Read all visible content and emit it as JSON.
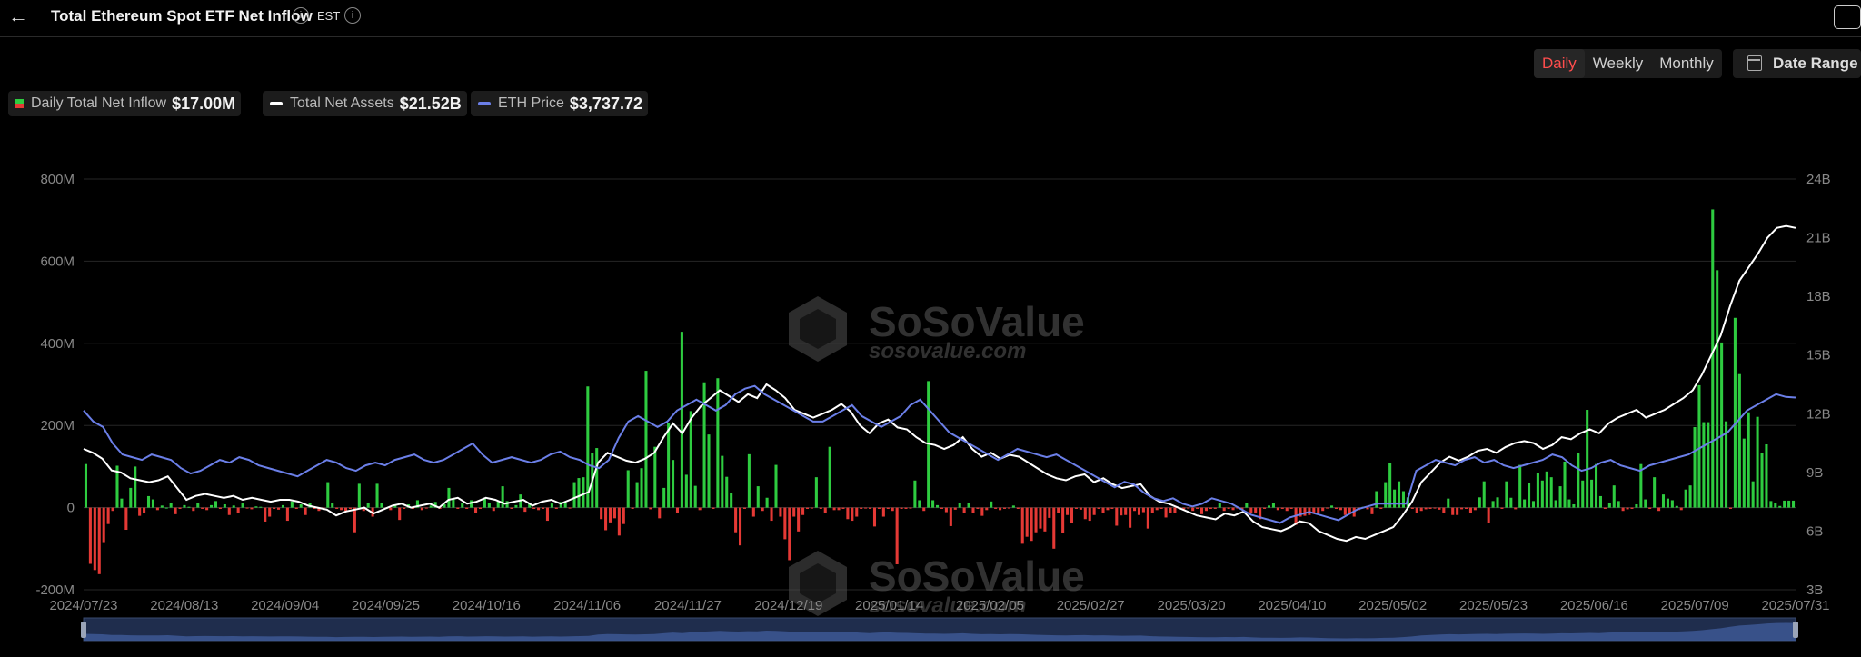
{
  "header": {
    "title": "Total Ethereum Spot ETF Net Inflow",
    "timezone": "EST",
    "info_glyph": "i"
  },
  "period_tabs": [
    {
      "label": "Daily",
      "active": true
    },
    {
      "label": "Weekly",
      "active": false
    },
    {
      "label": "Monthly",
      "active": false
    }
  ],
  "date_range_label": "Date Range",
  "legend": [
    {
      "label": "Daily Total Net Inflow",
      "value": "$17.00M",
      "color": "#2ecc40"
    },
    {
      "label": "Total Net Assets",
      "value": "$21.52B",
      "color": "#ffffff"
    },
    {
      "label": "ETH Price",
      "value": "$3,737.72",
      "color": "#6b7fe8"
    }
  ],
  "watermark": {
    "name": "SoSoValue",
    "url": "sosovalue.com"
  },
  "chart_data": {
    "type": "bar",
    "x": [
      "2024/07/23",
      "2024/08/13",
      "2024/09/04",
      "2024/09/25",
      "2024/10/16",
      "2024/11/06",
      "2024/11/27",
      "2024/12/19",
      "2025/01/14",
      "2025/02/05",
      "2025/02/27",
      "2025/03/20",
      "2025/04/10",
      "2025/05/02",
      "2025/05/23",
      "2025/06/16",
      "2025/07/09",
      "2025/07/31"
    ],
    "y_left": {
      "ticks": [
        "-200M",
        "0",
        "200M",
        "400M",
        "600M",
        "800M"
      ],
      "range": [
        -200,
        800
      ],
      "unit": "M"
    },
    "y_right": {
      "ticks": [
        "3B",
        "6B",
        "9B",
        "12B",
        "15B",
        "18B",
        "21B",
        "24B"
      ],
      "range": [
        3,
        24
      ],
      "unit": "B"
    },
    "series": [
      {
        "name": "Daily Total Net Inflow",
        "type": "bar",
        "unit": "M",
        "positive_color": "#2ecc40",
        "negative_color": "#e53935",
        "values": [
          106,
          -137,
          -152,
          -162,
          -84,
          -40,
          -8,
          102,
          22,
          -54,
          48,
          100,
          -20,
          -12,
          28,
          20,
          -6,
          5,
          0,
          12,
          -16,
          -3,
          6,
          2,
          -8,
          12,
          -3,
          -6,
          6,
          16,
          -3,
          8,
          -18,
          5,
          -12,
          12,
          -2,
          -4,
          3,
          2,
          -34,
          -22,
          -3,
          -5,
          6,
          -32,
          15,
          -3,
          8,
          -18,
          12,
          -3,
          -8,
          -2,
          62,
          12,
          -3,
          -6,
          -8,
          -3,
          -60,
          58,
          -8,
          12,
          -22,
          58,
          12,
          -3,
          -6,
          8,
          -30,
          -3,
          8,
          -3,
          18,
          -6,
          -2,
          5,
          14,
          -3,
          8,
          48,
          22,
          -3,
          12,
          -3,
          18,
          -12,
          -3,
          22,
          12,
          -8,
          15,
          52,
          16,
          -3,
          6,
          32,
          -10,
          12,
          -3,
          -6,
          -3,
          -32,
          10,
          -3,
          14,
          12,
          -2,
          62,
          72,
          74,
          295,
          134,
          145,
          -28,
          -55,
          -36,
          -26,
          -68,
          -40,
          91,
          -3,
          62,
          96,
          333,
          -4,
          148,
          -26,
          48,
          205,
          116,
          -14,
          428,
          80,
          235,
          53,
          -6,
          305,
          178,
          -3,
          315,
          126,
          75,
          36,
          -60,
          -92,
          -3,
          130,
          -22,
          52,
          -8,
          24,
          -32,
          104,
          -22,
          -77,
          -128,
          -22,
          -58,
          -18,
          -3,
          -2,
          74,
          -3,
          -12,
          148,
          -6,
          -6,
          -3,
          -28,
          -32,
          -22,
          -3,
          -2,
          -3,
          -46,
          -3,
          -22,
          -3,
          -8,
          -138,
          -3,
          -3,
          -2,
          66,
          18,
          -8,
          308,
          18,
          6,
          -3,
          -11,
          -45,
          -5,
          12,
          -13,
          12,
          -12,
          -3,
          -20,
          -6,
          15,
          -3,
          -6,
          -3,
          -2,
          5,
          -3,
          -88,
          -71,
          -81,
          -60,
          -51,
          -58,
          -25,
          -100,
          -12,
          -62,
          -18,
          -38,
          -3,
          -5,
          -28,
          -32,
          -18,
          -3,
          -12,
          -6,
          -3,
          -44,
          -19,
          -18,
          -49,
          -8,
          -18,
          -11,
          -51,
          -14,
          -6,
          -3,
          -24,
          -14,
          -12,
          -3,
          -4,
          -2,
          -8,
          -3,
          -16,
          -8,
          -3,
          -3,
          12,
          -8,
          -3,
          -6,
          -2,
          -5,
          12,
          -12,
          -14,
          -28,
          -3,
          5,
          12,
          -6,
          -3,
          -8,
          -3,
          -42,
          -22,
          -20,
          -18,
          -12,
          -14,
          -8,
          -2,
          5,
          -3,
          -6,
          -18,
          -12,
          -22,
          -6,
          2,
          -4,
          -16,
          40,
          -3,
          62,
          108,
          44,
          64,
          40,
          25,
          -3,
          -12,
          -8,
          -4,
          -3,
          -2,
          -5,
          -12,
          22,
          -18,
          -18,
          -4,
          -3,
          -12,
          -6,
          25,
          64,
          -38,
          16,
          25,
          -3,
          64,
          24,
          -4,
          104,
          20,
          60,
          16,
          84,
          66,
          88,
          74,
          18,
          52,
          112,
          20,
          8,
          134,
          66,
          238,
          68,
          106,
          28,
          -3,
          12,
          54,
          16,
          -8,
          -4,
          -3,
          8,
          106,
          20,
          -3,
          74,
          -8,
          32,
          22,
          18,
          4,
          -6,
          44,
          54,
          196,
          298,
          208,
          208,
          726,
          578,
          402,
          210,
          -3,
          462,
          325,
          168,
          232,
          64,
          221,
          134,
          154,
          16,
          11,
          4,
          17,
          17,
          17
        ]
      },
      {
        "name": "Total Net Assets",
        "type": "line",
        "unit": "B",
        "color": "#ffffff",
        "values": [
          10.2,
          10.0,
          9.7,
          9.1,
          9.0,
          8.7,
          8.6,
          8.5,
          8.6,
          8.8,
          8.2,
          7.6,
          7.8,
          7.9,
          7.8,
          7.7,
          7.8,
          7.6,
          7.7,
          7.6,
          7.5,
          7.6,
          7.6,
          7.5,
          7.3,
          7.2,
          7.1,
          6.8,
          7.0,
          7.1,
          7.2,
          6.9,
          7.1,
          7.3,
          7.4,
          7.2,
          7.3,
          7.4,
          7.2,
          7.6,
          7.7,
          7.4,
          7.5,
          7.7,
          7.6,
          7.4,
          7.5,
          7.6,
          7.3,
          7.5,
          7.6,
          7.4,
          7.6,
          7.8,
          8.0,
          9.5,
          10.0,
          9.8,
          9.6,
          9.5,
          9.7,
          10.0,
          10.8,
          11.5,
          11.0,
          11.8,
          12.4,
          12.8,
          13.2,
          12.9,
          12.6,
          13.0,
          12.8,
          13.5,
          13.2,
          12.8,
          12.2,
          12.0,
          11.8,
          12.0,
          12.2,
          12.5,
          12.1,
          11.4,
          11.0,
          11.5,
          11.7,
          11.3,
          11.2,
          10.8,
          10.5,
          10.4,
          10.2,
          10.4,
          10.8,
          10.2,
          9.8,
          10.0,
          9.7,
          9.9,
          9.8,
          9.5,
          9.2,
          8.9,
          8.7,
          8.6,
          8.8,
          8.9,
          8.5,
          8.7,
          8.4,
          8.2,
          8.3,
          8.4,
          7.8,
          7.5,
          7.4,
          7.2,
          7.0,
          6.8,
          6.7,
          6.6,
          6.9,
          6.8,
          7.0,
          6.5,
          6.2,
          6.1,
          6.0,
          6.2,
          6.5,
          6.4,
          6.0,
          5.8,
          5.6,
          5.5,
          5.7,
          5.6,
          5.8,
          6.0,
          6.2,
          6.8,
          7.5,
          8.5,
          9.0,
          9.5,
          9.8,
          9.6,
          9.8,
          10.1,
          10.2,
          10.0,
          10.3,
          10.5,
          10.6,
          10.5,
          10.2,
          10.4,
          10.8,
          10.7,
          11.0,
          11.2,
          11.0,
          11.5,
          11.8,
          12.0,
          12.2,
          11.8,
          12.0,
          12.2,
          12.5,
          12.8,
          13.2,
          14.0,
          15.0,
          16.0,
          17.5,
          18.8,
          19.5,
          20.2,
          21.0,
          21.5,
          21.6,
          21.5
        ]
      },
      {
        "name": "ETH Price",
        "type": "line",
        "unit": "$",
        "color": "#6b7fe8",
        "values": [
          3500,
          3300,
          3200,
          2900,
          2700,
          2650,
          2600,
          2700,
          2650,
          2600,
          2450,
          2350,
          2400,
          2500,
          2600,
          2550,
          2650,
          2600,
          2500,
          2450,
          2400,
          2350,
          2300,
          2400,
          2500,
          2600,
          2550,
          2450,
          2400,
          2500,
          2550,
          2500,
          2600,
          2650,
          2700,
          2600,
          2550,
          2600,
          2700,
          2800,
          2900,
          2700,
          2550,
          2600,
          2650,
          2600,
          2550,
          2600,
          2700,
          2750,
          2650,
          2600,
          2500,
          2450,
          2600,
          3000,
          3300,
          3400,
          3300,
          3200,
          3300,
          3500,
          3600,
          3700,
          3600,
          3500,
          3600,
          3800,
          3900,
          3950,
          3800,
          3700,
          3600,
          3500,
          3400,
          3300,
          3300,
          3400,
          3500,
          3600,
          3400,
          3300,
          3200,
          3300,
          3400,
          3600,
          3700,
          3500,
          3300,
          3100,
          3000,
          2900,
          2800,
          2700,
          2600,
          2700,
          2800,
          2750,
          2700,
          2650,
          2700,
          2600,
          2500,
          2400,
          2300,
          2200,
          2100,
          2200,
          2150,
          2000,
          1900,
          1850,
          1900,
          1800,
          1750,
          1800,
          1900,
          1850,
          1800,
          1700,
          1600,
          1550,
          1500,
          1450,
          1550,
          1600,
          1650,
          1600,
          1550,
          1500,
          1600,
          1700,
          1750,
          1800,
          1800,
          1800,
          1800,
          2400,
          2500,
          2600,
          2550,
          2500,
          2600,
          2650,
          2550,
          2600,
          2500,
          2450,
          2500,
          2550,
          2600,
          2700,
          2650,
          2500,
          2400,
          2450,
          2550,
          2600,
          2500,
          2450,
          2400,
          2500,
          2550,
          2600,
          2650,
          2700,
          2800,
          2900,
          3000,
          3100,
          3300,
          3500,
          3600,
          3700,
          3800,
          3750,
          3738
        ]
      }
    ],
    "legend_position": "top-left",
    "grid": true
  }
}
